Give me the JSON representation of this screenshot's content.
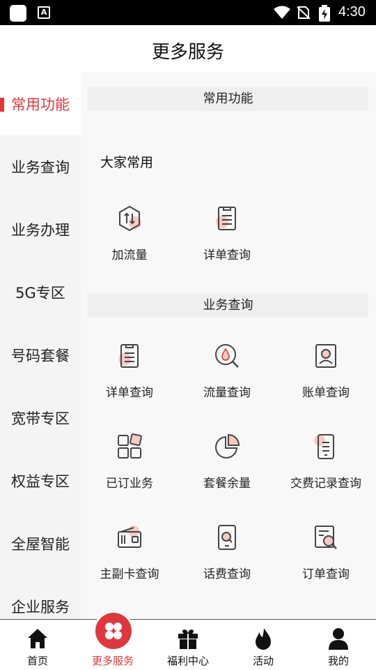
{
  "status_bar": {
    "time": "4:30",
    "a_icon_letter": "A"
  },
  "header": {
    "title": "更多服务"
  },
  "sidebar": {
    "items": [
      {
        "label": "常用功能",
        "active": true
      },
      {
        "label": "业务查询",
        "active": false
      },
      {
        "label": "业务办理",
        "active": false
      },
      {
        "label": "5G专区",
        "active": false
      },
      {
        "label": "号码套餐",
        "active": false
      },
      {
        "label": "宽带专区",
        "active": false
      },
      {
        "label": "权益专区",
        "active": false
      },
      {
        "label": "全屋智能",
        "active": false
      },
      {
        "label": "企业服务",
        "active": false
      }
    ]
  },
  "sections": [
    {
      "title": "常用功能",
      "subtitle": "大家常用",
      "items": [
        {
          "label": "加流量",
          "icon": "traffic-add-icon"
        },
        {
          "label": "详单查询",
          "icon": "detail-list-icon"
        }
      ]
    },
    {
      "title": "业务查询",
      "items": [
        {
          "label": "详单查询",
          "icon": "detail-list-icon"
        },
        {
          "label": "流量查询",
          "icon": "traffic-query-icon"
        },
        {
          "label": "账单查询",
          "icon": "bill-icon"
        },
        {
          "label": "已订业务",
          "icon": "subscribed-grid-icon"
        },
        {
          "label": "套餐余量",
          "icon": "pie-chart-icon"
        },
        {
          "label": "交费记录查询",
          "icon": "payment-record-icon"
        },
        {
          "label": "主副卡查询",
          "icon": "wallet-card-icon"
        },
        {
          "label": "话费查询",
          "icon": "phone-fee-icon"
        },
        {
          "label": "订单查询",
          "icon": "order-search-icon"
        }
      ]
    }
  ],
  "bottom_nav": {
    "items": [
      {
        "label": "首页",
        "icon": "home-icon",
        "active": false
      },
      {
        "label": "更多服务",
        "icon": "more-services-icon",
        "active": true
      },
      {
        "label": "福利中心",
        "icon": "gift-icon",
        "active": false
      },
      {
        "label": "活动",
        "icon": "flame-icon",
        "active": false
      },
      {
        "label": "我的",
        "icon": "user-icon",
        "active": false
      }
    ]
  },
  "colors": {
    "accent": "#e0373c",
    "sidebar_bg": "#f4f4f4",
    "content_bg": "#f8f8f8",
    "icon_stroke": "#444444",
    "icon_blush": "#f7c9c4"
  }
}
